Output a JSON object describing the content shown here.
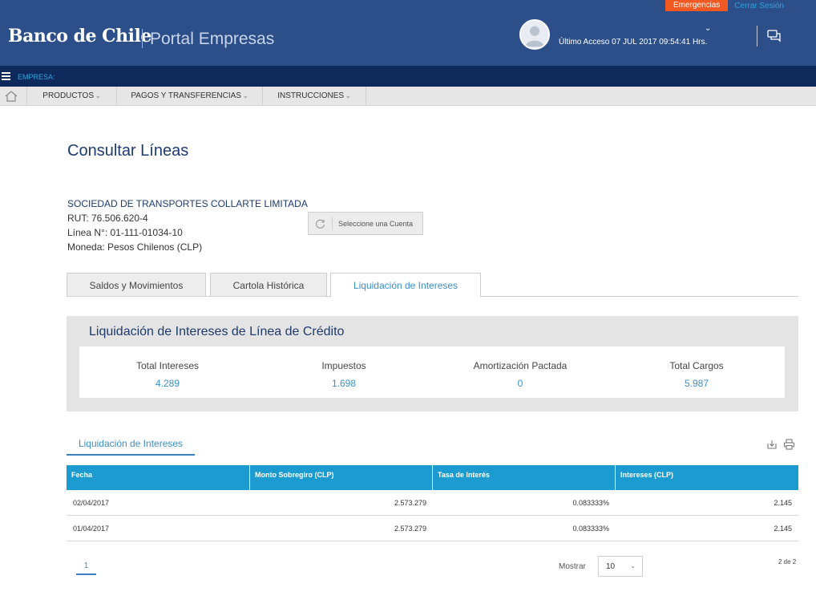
{
  "header": {
    "emergency_label": "Emergencias",
    "logout_label": "Cerrar Sesión",
    "logo_text": "Banco de Chile",
    "portal_name": "Portal Empresas",
    "last_access": "Último Acceso 07 JUL 2017 09:54:41 Hrs.",
    "avatar_icon": "user-avatar-icon",
    "chat_icon": "chat-icon",
    "background_color": "#2c4f8a"
  },
  "empresa_bar": {
    "label": "EMPRESA:"
  },
  "nav": {
    "items": [
      {
        "label": "PRODUCTOS"
      },
      {
        "label": "PAGOS Y TRANSFERENCIAS"
      },
      {
        "label": "INSTRUCCIONES"
      }
    ]
  },
  "page": {
    "title": "Consultar Líneas"
  },
  "company": {
    "name": "SOCIEDAD DE TRANSPORTES COLLARTE LIMITADA",
    "rut": "RUT: 76.506.620-4",
    "line": "Línea N°: 01-111-01034-10",
    "currency": "Moneda: Pesos Chilenos (CLP)"
  },
  "select_account": {
    "label": "Seleccione una Cuenta"
  },
  "tabs": [
    {
      "label": "Saldos y Movimientos",
      "active": false
    },
    {
      "label": "Cartola Histórica",
      "active": false
    },
    {
      "label": "Liquidación de Intereses",
      "active": true
    }
  ],
  "summary": {
    "title": "Liquidación de Intereses de Línea de Crédito",
    "stats": [
      {
        "label": "Total Intereses",
        "value": "4.289"
      },
      {
        "label": "Impuestos",
        "value": "1.698"
      },
      {
        "label": "Amortización Pactada",
        "value": "0"
      },
      {
        "label": "Total Cargos",
        "value": "5.987"
      }
    ]
  },
  "subtab": {
    "label": "Liquidación de Intereses"
  },
  "table": {
    "headers": [
      "Fecha",
      "Monto Sobregiro (CLP)",
      "Tasa de Interés",
      "Intereses (CLP)"
    ],
    "rows": [
      [
        "02/04/2017",
        "2.573.279",
        "0.083333%",
        "2.145"
      ],
      [
        "01/04/2017",
        "2.573.279",
        "0.083333%",
        "2.145"
      ]
    ]
  },
  "pagination": {
    "current_page": "1",
    "show_label": "Mostrar",
    "page_size": "10",
    "count_text": "2 de 2"
  },
  "colors": {
    "accent": "#3a8fc8",
    "table_header": "#1b9bcf",
    "dark_navy": "#0e2a5c",
    "emergency": "#f05a22"
  }
}
